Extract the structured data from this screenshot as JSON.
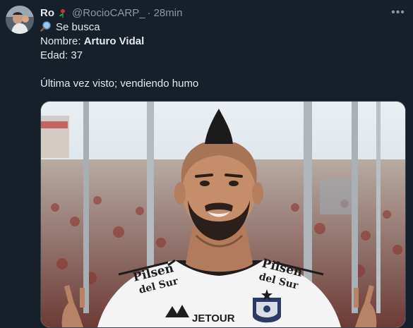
{
  "tweet": {
    "author_name": "Ro",
    "author_handle": "@RocioCARP_",
    "separator": "·",
    "timestamp": "28min",
    "more_label": "•••",
    "lines": {
      "line1": "Se busca",
      "line2_label": "Nombre: ",
      "line2_value": "Arturo Vidal",
      "line3": "Edad: 37",
      "line5": "Última vez visto; vendiendo humo"
    },
    "media": {
      "sponsor_text_line1": "Pilsen",
      "sponsor_text_line2": "del Sur",
      "front_text": "JETOUR"
    }
  },
  "colors": {
    "background": "#15202b",
    "text": "#e7e9ea",
    "secondary_text": "#8b98a5"
  },
  "icons": {
    "rose": "rose-icon",
    "search": "magnifying-glass-icon",
    "more": "more-icon"
  }
}
